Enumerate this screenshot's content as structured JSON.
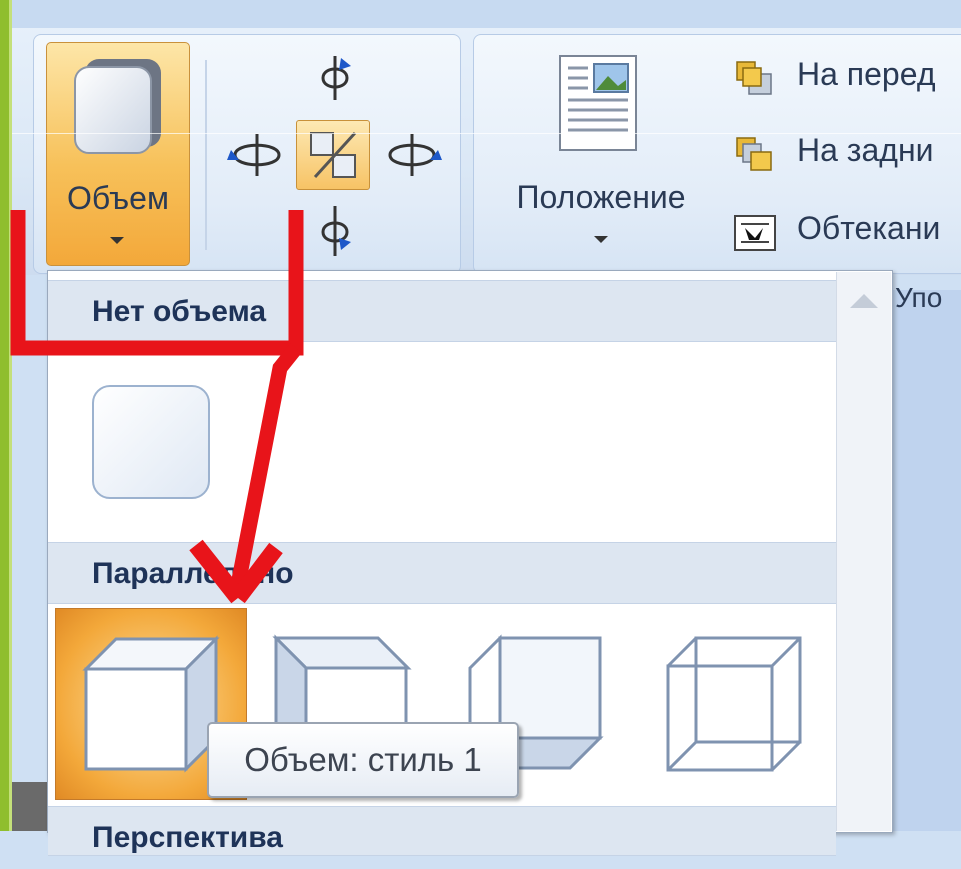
{
  "ribbon": {
    "volume_label": "Объем",
    "position_label": "Положение",
    "arrange_items": [
      {
        "label": "На перед",
        "icon": "bring-forward-icon"
      },
      {
        "label": "На задни",
        "icon": "send-backward-icon"
      },
      {
        "label": "Обтекани",
        "icon": "text-wrap-icon"
      }
    ],
    "group_label_partial": "Упо"
  },
  "gallery": {
    "sections": [
      {
        "title": "Нет объема"
      },
      {
        "title": "Параллельно"
      },
      {
        "title": "Перспектива"
      }
    ]
  },
  "tooltip": {
    "text": "Объем: стиль 1"
  },
  "colors": {
    "annotation_red": "#e8141a",
    "hover_orange": "#f3a83a",
    "header_blue": "#dde6f1"
  }
}
